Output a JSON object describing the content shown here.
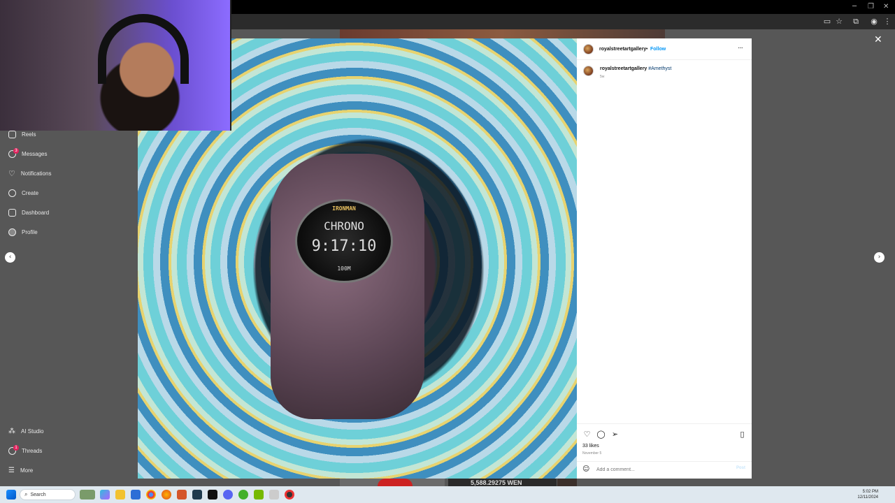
{
  "sidebar": {
    "items": [
      {
        "label": "Reels",
        "icon": "reels-icon"
      },
      {
        "label": "Messages",
        "icon": "messenger-icon",
        "badge": "3"
      },
      {
        "label": "Notifications",
        "icon": "heart-icon"
      },
      {
        "label": "Create",
        "icon": "plus-square-icon"
      },
      {
        "label": "Dashboard",
        "icon": "dashboard-icon"
      },
      {
        "label": "Profile",
        "icon": "profile-avatar-icon"
      }
    ],
    "bottom_items": [
      {
        "label": "AI Studio",
        "icon": "ai-studio-icon"
      },
      {
        "label": "Threads",
        "icon": "threads-icon",
        "badge": "1"
      },
      {
        "label": "More",
        "icon": "hamburger-icon"
      }
    ]
  },
  "post": {
    "username": "royalstreetartgallery",
    "follow_label": "Follow",
    "separator": "•",
    "more_label": "···",
    "caption_user": "royalstreetartgallery",
    "caption_text": "#Amethyst",
    "caption_age": "5w",
    "likes": "33 likes",
    "date": "November 5",
    "comment_placeholder": "Add a comment...",
    "post_label": "Post",
    "image": {
      "watch_brand": "IRONMAN",
      "watch_mode": "CHRONO",
      "watch_time": "9:17:10",
      "watch_bottom": "100M"
    }
  },
  "overlay": {
    "close_label": "✕",
    "prev_label": "‹",
    "next_label": "›"
  },
  "background": {
    "ticker_text": "5,588.29275 WEN"
  },
  "taskbar": {
    "search_label": "Search",
    "time": "5:02 PM",
    "date": "12/11/2024"
  },
  "colors": {
    "link_blue": "#0095f6",
    "badge_red": "#e0245e"
  }
}
